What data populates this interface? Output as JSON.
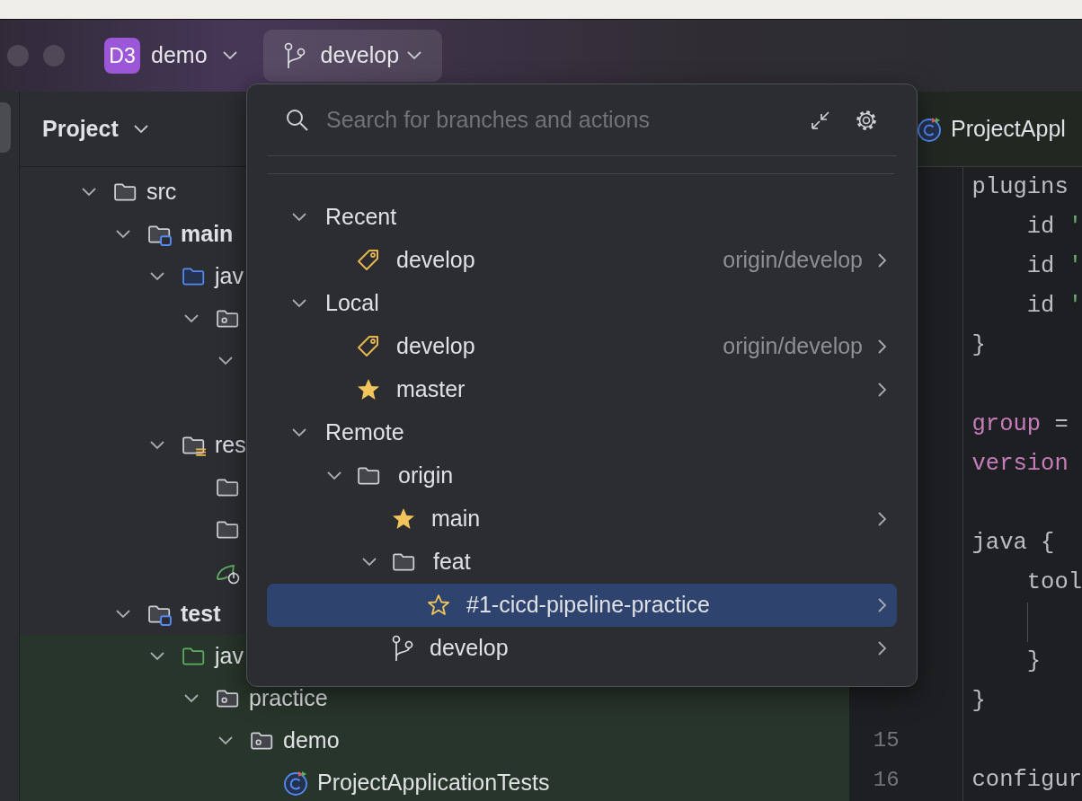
{
  "title_bar": {
    "project": {
      "badge": "D3",
      "name": "demo"
    },
    "branch": {
      "name": "develop",
      "open": true
    }
  },
  "project_panel": {
    "title": "Project",
    "tree": [
      {
        "kind": "folder",
        "label": "src",
        "expanded": true,
        "children": [
          {
            "kind": "module",
            "label": "main",
            "expanded": true,
            "children": [
              {
                "kind": "source-root",
                "label": "jav",
                "expanded": true,
                "children": [
                  {
                    "kind": "package",
                    "expanded": true,
                    "children": [
                      {
                        "expanded": true
                      }
                    ]
                  }
                ]
              },
              {
                "kind": "resources-root",
                "label": "res",
                "expanded": true,
                "children": [
                  {
                    "kind": "folder"
                  },
                  {
                    "kind": "folder"
                  },
                  {
                    "kind": "spring"
                  }
                ]
              }
            ]
          },
          {
            "kind": "module",
            "label": "test",
            "expanded": true,
            "children": [
              {
                "kind": "test-root",
                "label": "jav",
                "expanded": true,
                "children": [
                  {
                    "kind": "package",
                    "label": "practice",
                    "expanded": true,
                    "children": [
                      {
                        "kind": "package",
                        "label": "demo",
                        "expanded": true,
                        "children": [
                          {
                            "kind": "class",
                            "label": "ProjectApplicationTests"
                          }
                        ]
                      }
                    ]
                  }
                ]
              }
            ]
          }
        ]
      }
    ]
  },
  "editor": {
    "tab": {
      "label": "ProjectAppl"
    },
    "lines": [
      {
        "kind": "code",
        "tokens": [
          {
            "text": "plugins"
          }
        ]
      },
      {
        "kind": "code",
        "tokens": [
          {
            "text": "    id "
          },
          {
            "text": "'",
            "kind": "string"
          }
        ]
      },
      {
        "kind": "code",
        "tokens": [
          {
            "text": "    id "
          },
          {
            "text": "'",
            "kind": "string"
          }
        ]
      },
      {
        "kind": "code",
        "tokens": [
          {
            "text": "    id "
          },
          {
            "text": "'",
            "kind": "string"
          }
        ]
      },
      {
        "kind": "code",
        "tokens": [
          {
            "text": "}"
          }
        ]
      },
      {
        "kind": "blank"
      },
      {
        "kind": "code",
        "tokens": [
          {
            "text": "group",
            "kind": "keyword"
          },
          {
            "text": " ="
          }
        ]
      },
      {
        "kind": "code",
        "tokens": [
          {
            "text": "version",
            "kind": "keyword"
          }
        ]
      },
      {
        "kind": "blank"
      },
      {
        "kind": "code",
        "tokens": [
          {
            "text": "java {"
          }
        ]
      },
      {
        "kind": "code",
        "tokens": [
          {
            "text": "    tool"
          }
        ]
      },
      {
        "kind": "blank",
        "indent_guide": true
      },
      {
        "kind": "code",
        "tokens": [
          {
            "text": "    }"
          }
        ]
      },
      {
        "kind": "code",
        "tokens": [
          {
            "text": "}"
          }
        ]
      },
      {
        "kind": "blank",
        "number": "15"
      },
      {
        "kind": "code",
        "number": "16",
        "tokens": [
          {
            "text": "configur"
          }
        ]
      }
    ]
  },
  "branch_popup": {
    "search": {
      "placeholder": "Search for branches and actions"
    },
    "items": [
      {
        "kind": "group",
        "label": "Recent",
        "expanded": true,
        "selected": false,
        "children": [
          {
            "kind": "current",
            "label": "develop",
            "tracking": "origin/develop",
            "selected": false
          }
        ]
      },
      {
        "kind": "group",
        "label": "Local",
        "expanded": true,
        "selected": false,
        "children": [
          {
            "kind": "current",
            "label": "develop",
            "tracking": "origin/develop",
            "selected": false
          },
          {
            "kind": "favorite",
            "label": "master",
            "selected": false
          }
        ]
      },
      {
        "kind": "group",
        "label": "Remote",
        "expanded": true,
        "selected": false,
        "children": [
          {
            "kind": "folder",
            "label": "origin",
            "expanded": true,
            "selected": false,
            "children": [
              {
                "kind": "favorite",
                "label": "main",
                "selected": false
              },
              {
                "kind": "folder",
                "label": "feat",
                "expanded": true,
                "selected": false,
                "children": [
                  {
                    "kind": "unstarred",
                    "label": "#1-cicd-pipeline-practice",
                    "selected": true
                  }
                ]
              },
              {
                "kind": "branch",
                "label": "develop",
                "selected": false
              }
            ]
          }
        ]
      }
    ]
  }
}
